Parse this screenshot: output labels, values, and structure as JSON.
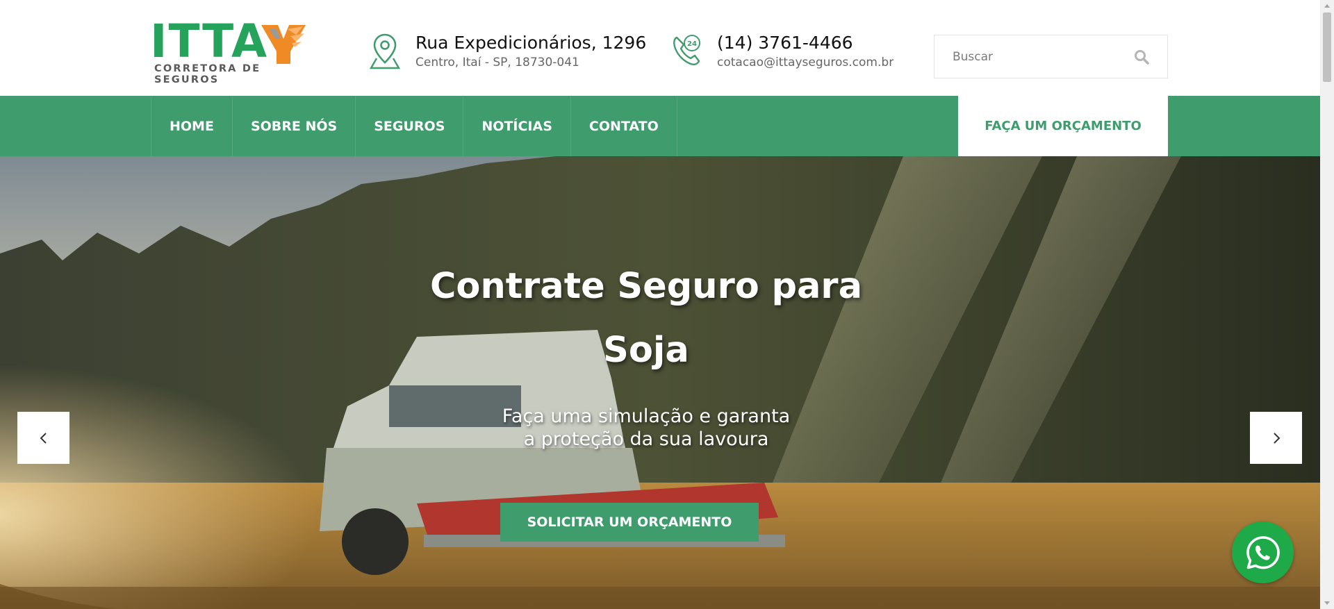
{
  "brand": {
    "logo_text": "ITTA",
    "logo_subtitle": "CORRETORA DE SEGUROS",
    "green": "#25a35a",
    "orange": "#f08a24"
  },
  "header": {
    "address": {
      "line1": "Rua Expedicionários, 1296",
      "line2": "Centro, Itaí - SP, 18730-041",
      "icon": "map-pin-icon"
    },
    "contact": {
      "phone": "(14) 3761-4466",
      "email": "cotacao@ittayseguros.com.br",
      "icon": "phone-24h-icon"
    },
    "search": {
      "placeholder": "Buscar",
      "icon": "search-icon"
    }
  },
  "nav": {
    "items": [
      {
        "label": "HOME"
      },
      {
        "label": "SOBRE NÓS"
      },
      {
        "label": "SEGUROS"
      },
      {
        "label": "NOTÍCIAS"
      },
      {
        "label": "CONTATO"
      }
    ],
    "cta_label": "FAÇA UM ORÇAMENTO",
    "color": "#3e9c6d"
  },
  "hero": {
    "title_line1": "Contrate Seguro para",
    "title_line2": "Soja",
    "subtitle_line1": "Faça uma simulação e garanta",
    "subtitle_line2": "a proteção da sua lavoura",
    "button_label": "SOLICITAR UM ORÇAMENTO",
    "prev_icon": "chevron-left-icon",
    "next_icon": "chevron-right-icon"
  },
  "floating": {
    "whatsapp_icon": "whatsapp-icon",
    "color": "#1faa4a"
  }
}
